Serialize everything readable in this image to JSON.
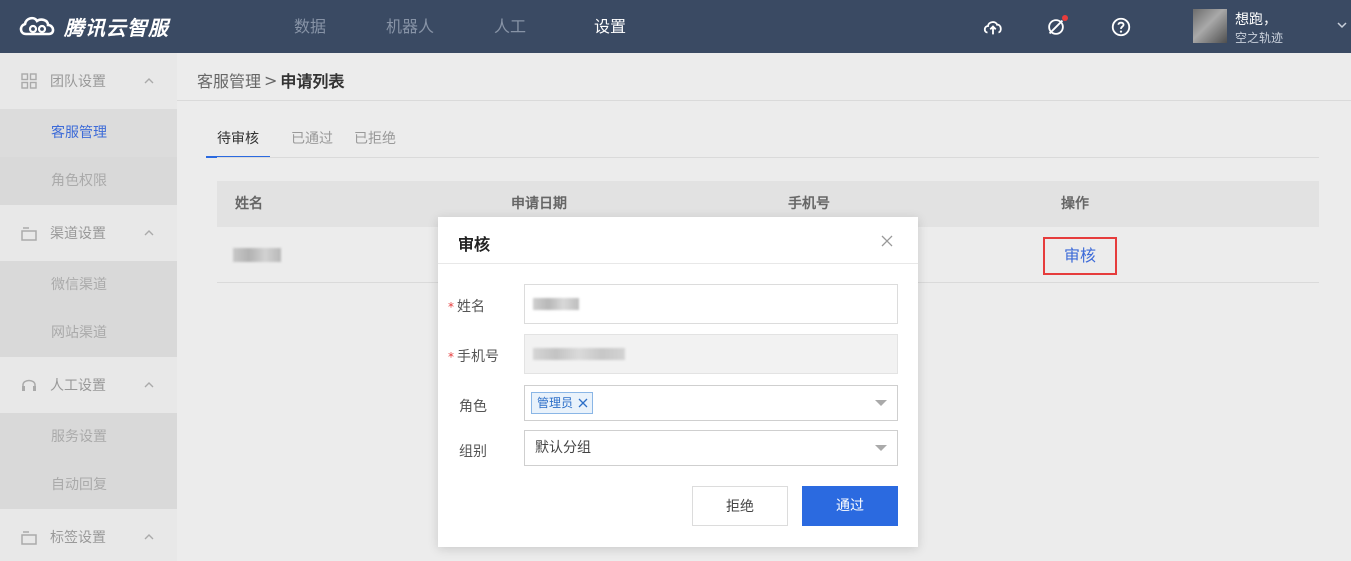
{
  "app": {
    "logo_text": "腾讯云智服",
    "nav": [
      {
        "label": "数据",
        "active": false
      },
      {
        "label": "机器人",
        "active": false
      },
      {
        "label": "人工",
        "active": false
      },
      {
        "label": "设置",
        "active": true
      }
    ],
    "user": {
      "name": "想跑，",
      "subtitle": "空之轨迹"
    }
  },
  "sidebar": {
    "groups": [
      {
        "label": "团队设置",
        "icon": "grid-icon",
        "items": [
          {
            "label": "客服管理",
            "active": true
          },
          {
            "label": "角色权限",
            "active": false
          }
        ]
      },
      {
        "label": "渠道设置",
        "icon": "folder-icon",
        "items": [
          {
            "label": "微信渠道",
            "active": false
          },
          {
            "label": "网站渠道",
            "active": false
          }
        ]
      },
      {
        "label": "人工设置",
        "icon": "headset-icon",
        "items": [
          {
            "label": "服务设置",
            "active": false
          },
          {
            "label": "自动回复",
            "active": false
          }
        ]
      },
      {
        "label": "标签设置",
        "icon": "folder-icon",
        "items": []
      }
    ]
  },
  "breadcrumb": {
    "parent": "客服管理",
    "separator": ">",
    "current": "申请列表"
  },
  "tabs": [
    {
      "label": "待审核",
      "active": true
    },
    {
      "label": "已通过",
      "active": false
    },
    {
      "label": "已拒绝",
      "active": false
    }
  ],
  "table": {
    "headers": [
      "姓名",
      "申请日期",
      "手机号",
      "操作"
    ],
    "rows": [
      {
        "action": "审核"
      }
    ]
  },
  "modal": {
    "title": "审核",
    "fields": {
      "name_label": "姓名",
      "phone_label": "手机号",
      "role_label": "角色",
      "role_tag": "管理员",
      "group_label": "组别",
      "group_value": "默认分组"
    },
    "reject_label": "拒绝",
    "pass_label": "通过"
  },
  "colors": {
    "topbar": "#3a4a63",
    "primary": "#2b6ae0",
    "highlight_border": "#e63c3c"
  }
}
